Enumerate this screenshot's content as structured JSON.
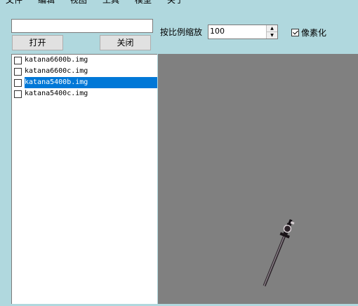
{
  "menu": [
    "文件",
    "编辑",
    "视图",
    "工具",
    "模型",
    "关于"
  ],
  "path_input": {
    "value": ""
  },
  "buttons": {
    "open": "打开",
    "close": "关闭"
  },
  "scale": {
    "label": "按比例缩放",
    "value": "100"
  },
  "pixelate": {
    "label": "像素化",
    "checked": true
  },
  "files": [
    {
      "name": "katana6600b.img",
      "checked": false,
      "selected": false
    },
    {
      "name": "katana6600c.img",
      "checked": false,
      "selected": false
    },
    {
      "name": "katana5400b.img",
      "checked": false,
      "selected": true
    },
    {
      "name": "katana5400c.img",
      "checked": false,
      "selected": false
    }
  ],
  "canvas": {
    "background": "#808080",
    "sprite_icon": "katana-sprite"
  }
}
